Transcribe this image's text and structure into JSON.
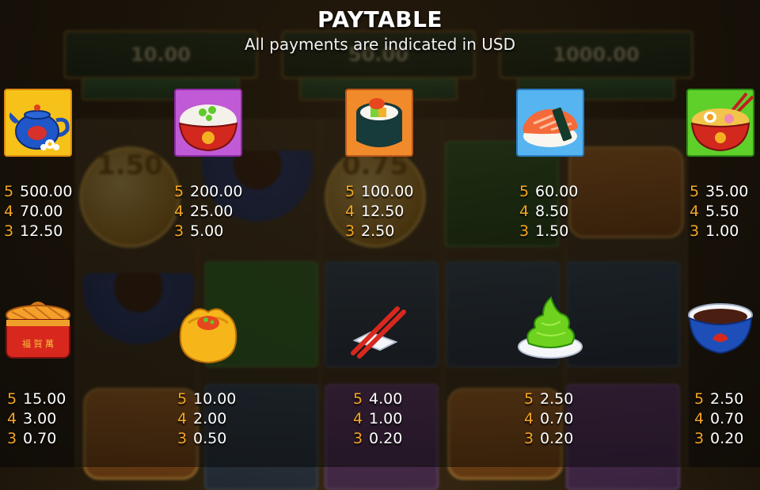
{
  "header": {
    "title": "PAYTABLE",
    "subtitle": "All payments are indicated in USD"
  },
  "background": {
    "jackpots": [
      "10.00",
      "50.00",
      "1000.00"
    ],
    "coin_values": [
      "1.50",
      "0.75"
    ]
  },
  "colors": {
    "count_color": "#f5a623",
    "value_color": "#ffffff"
  },
  "symbols": [
    {
      "icon": "teapot-icon",
      "tile": "gold",
      "pays": [
        {
          "count": "5",
          "value": "500.00"
        },
        {
          "count": "4",
          "value": "70.00"
        },
        {
          "count": "3",
          "value": "12.50"
        }
      ]
    },
    {
      "icon": "rice-bowl-icon",
      "tile": "purple",
      "pays": [
        {
          "count": "5",
          "value": "200.00"
        },
        {
          "count": "4",
          "value": "25.00"
        },
        {
          "count": "3",
          "value": "5.00"
        }
      ]
    },
    {
      "icon": "sushi-roll-icon",
      "tile": "orange",
      "pays": [
        {
          "count": "5",
          "value": "100.00"
        },
        {
          "count": "4",
          "value": "12.50"
        },
        {
          "count": "3",
          "value": "2.50"
        }
      ]
    },
    {
      "icon": "salmon-nigiri-icon",
      "tile": "blue",
      "pays": [
        {
          "count": "5",
          "value": "60.00"
        },
        {
          "count": "4",
          "value": "8.50"
        },
        {
          "count": "3",
          "value": "1.50"
        }
      ]
    },
    {
      "icon": "ramen-bowl-icon",
      "tile": "green",
      "pays": [
        {
          "count": "5",
          "value": "35.00"
        },
        {
          "count": "4",
          "value": "5.50"
        },
        {
          "count": "3",
          "value": "1.00"
        }
      ]
    },
    {
      "icon": "bamboo-basket-icon",
      "tile": "none",
      "pays": [
        {
          "count": "5",
          "value": "15.00"
        },
        {
          "count": "4",
          "value": "3.00"
        },
        {
          "count": "3",
          "value": "0.70"
        }
      ]
    },
    {
      "icon": "dumpling-icon",
      "tile": "none",
      "pays": [
        {
          "count": "5",
          "value": "10.00"
        },
        {
          "count": "4",
          "value": "2.00"
        },
        {
          "count": "3",
          "value": "0.50"
        }
      ]
    },
    {
      "icon": "chopsticks-icon",
      "tile": "none",
      "pays": [
        {
          "count": "5",
          "value": "4.00"
        },
        {
          "count": "4",
          "value": "1.00"
        },
        {
          "count": "3",
          "value": "0.20"
        }
      ]
    },
    {
      "icon": "wasabi-icon",
      "tile": "none",
      "pays": [
        {
          "count": "5",
          "value": "2.50"
        },
        {
          "count": "4",
          "value": "0.70"
        },
        {
          "count": "3",
          "value": "0.20"
        }
      ]
    },
    {
      "icon": "soy-sauce-bowl-icon",
      "tile": "none",
      "pays": [
        {
          "count": "5",
          "value": "2.50"
        },
        {
          "count": "4",
          "value": "0.70"
        },
        {
          "count": "3",
          "value": "0.20"
        }
      ]
    }
  ]
}
